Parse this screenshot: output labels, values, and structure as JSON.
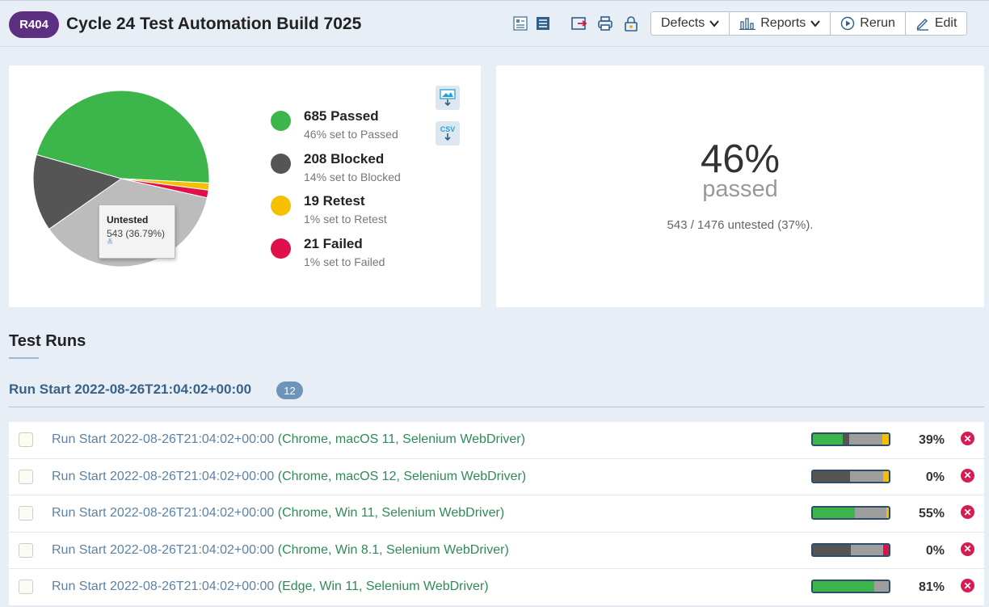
{
  "header": {
    "run_id": "R404",
    "title": "Cycle 24 Test Automation Build 7025",
    "toolbar": [
      {
        "label": "Defects",
        "icon": "chevron-down-icon"
      },
      {
        "label": "Reports",
        "icon": "chart-bars-icon"
      },
      {
        "label": "Rerun",
        "icon": "play-circle-icon"
      },
      {
        "label": "Edit",
        "icon": "pencil-icon"
      }
    ],
    "icons": [
      "details-view-icon",
      "list-view-icon",
      "export-icon",
      "print-icon",
      "lock-icon"
    ]
  },
  "summary": {
    "legend": [
      {
        "main": "685 Passed",
        "sub": "46% set to Passed",
        "color": "#3cb54a"
      },
      {
        "main": "208 Blocked",
        "sub": "14% set to Blocked",
        "color": "#555555"
      },
      {
        "main": "19 Retest",
        "sub": "1% set to Retest",
        "color": "#f6c000"
      },
      {
        "main": "21 Failed",
        "sub": "1% set to Failed",
        "color": "#e0104a"
      }
    ],
    "export_labels": [
      "CSV"
    ],
    "tooltip": {
      "title": "Untested",
      "value": "543 (36.79%)"
    }
  },
  "chart_data": {
    "type": "pie",
    "slices": [
      {
        "label": "Passed",
        "value": 685,
        "color": "#3cb54a"
      },
      {
        "label": "Retest",
        "value": 19,
        "color": "#f6c000"
      },
      {
        "label": "Failed",
        "value": 21,
        "color": "#e0104a"
      },
      {
        "label": "Untested",
        "value": 543,
        "color": "#bcbcbc"
      },
      {
        "label": "Blocked",
        "value": 208,
        "color": "#555555"
      }
    ]
  },
  "stats": {
    "percent": "46%",
    "label": "passed",
    "untested_line": "543 / 1476 untested (37%)."
  },
  "test_runs": {
    "section_title": "Test Runs",
    "group_title": "Run Start 2022-08-26T21:04:02+00:00",
    "group_count": "12",
    "runs": [
      {
        "name": "Run Start 2022-08-26T21:04:02+00:00",
        "config": "(Chrome, macOS 11, Selenium WebDriver)",
        "pct": "39%",
        "bar": {
          "passed": 0.39,
          "blocked": 0.09,
          "untested": 0.43,
          "retest": 0.09,
          "failed": 0
        }
      },
      {
        "name": "Run Start 2022-08-26T21:04:02+00:00",
        "config": "(Chrome, macOS 12, Selenium WebDriver)",
        "pct": "0%",
        "bar": {
          "passed": 0,
          "blocked": 0.49,
          "untested": 0.44,
          "retest": 0.07,
          "failed": 0
        }
      },
      {
        "name": "Run Start 2022-08-26T21:04:02+00:00",
        "config": "(Chrome, Win 11, Selenium WebDriver)",
        "pct": "55%",
        "bar": {
          "passed": 0.55,
          "blocked": 0,
          "untested": 0.42,
          "retest": 0.03,
          "failed": 0
        }
      },
      {
        "name": "Run Start 2022-08-26T21:04:02+00:00",
        "config": "(Chrome, Win 8.1, Selenium WebDriver)",
        "pct": "0%",
        "bar": {
          "passed": 0,
          "blocked": 0.5,
          "untested": 0.43,
          "retest": 0,
          "failed": 0.07
        }
      },
      {
        "name": "Run Start 2022-08-26T21:04:02+00:00",
        "config": "(Edge, Win 11, Selenium WebDriver)",
        "pct": "81%",
        "bar": {
          "passed": 0.81,
          "blocked": 0,
          "untested": 0.19,
          "retest": 0,
          "failed": 0
        }
      }
    ]
  },
  "colors": {
    "passed": "#3cb54a",
    "blocked": "#555555",
    "untested": "#9e9e9e",
    "retest": "#f6c000",
    "failed": "#e0104a",
    "brand": "#5c2f83"
  }
}
